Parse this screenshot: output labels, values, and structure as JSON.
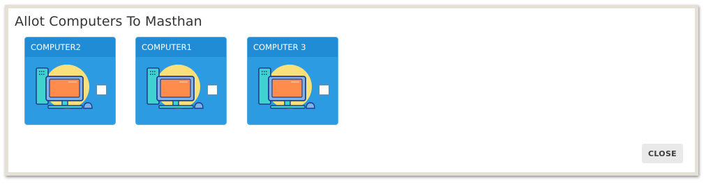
{
  "dialog": {
    "title": "Allot Computers To Masthan",
    "close_label": "CLOSE"
  },
  "computers": [
    {
      "name": "COMPUTER2",
      "checked": false,
      "icon": "desktop-computer-icon"
    },
    {
      "name": "COMPUTER1",
      "checked": false,
      "icon": "desktop-computer-icon"
    },
    {
      "name": "COMPUTER 3",
      "checked": false,
      "icon": "desktop-computer-icon"
    }
  ],
  "colors": {
    "card_background": "#2d9be2",
    "card_header": "#1f8cd5",
    "icon_circle": "#f9e07a",
    "icon_screen": "#ff8c4a",
    "frame_border": "#e5e1d6"
  }
}
